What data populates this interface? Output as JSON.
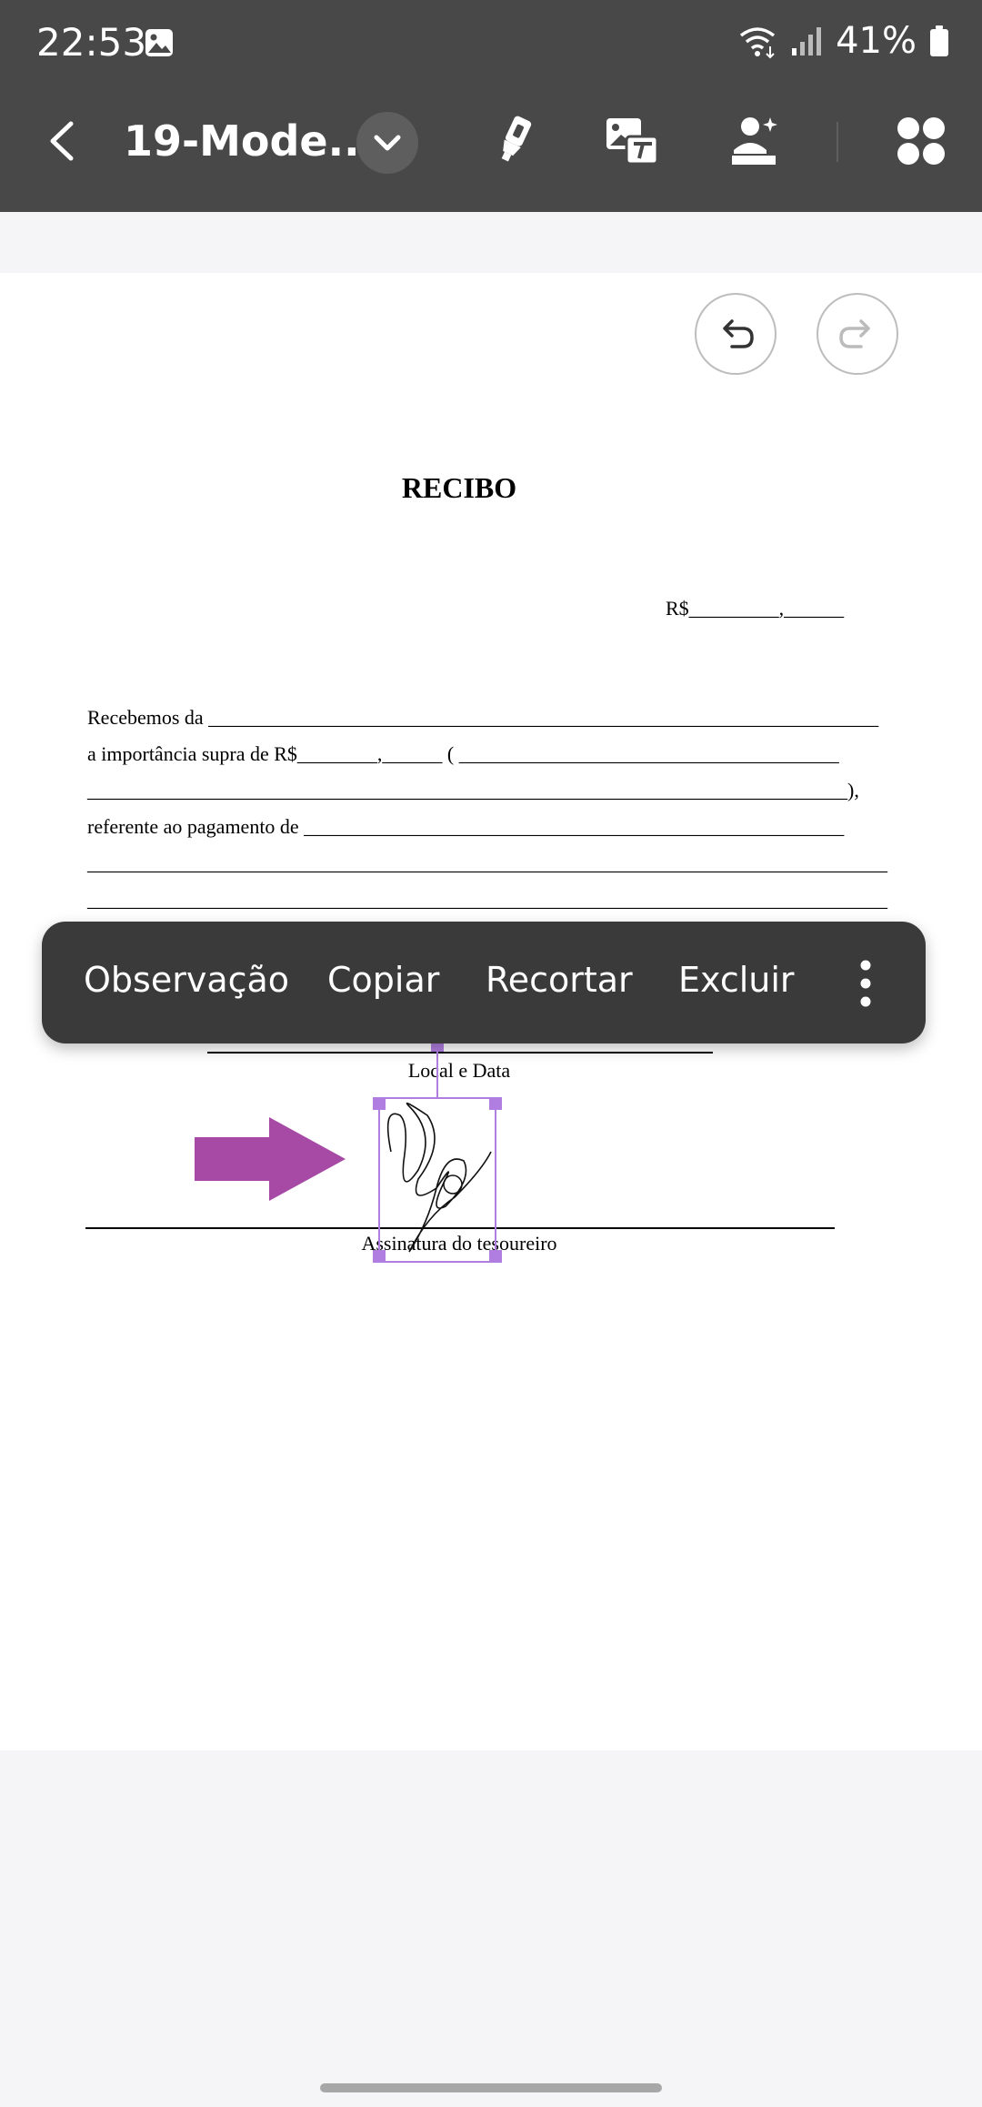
{
  "status_bar": {
    "time": "22:53",
    "battery": "41%"
  },
  "toolbar": {
    "title": "19-Mode..."
  },
  "document": {
    "title": "RECIBO",
    "amount_line": "R$_________,______",
    "lines": [
      "Recebemos da ___________________________________________________________________",
      "a importância supra de R$________,______ ( ______________________________________",
      "____________________________________________________________________________),",
      "referente ao pagamento de  ______________________________________________________",
      "________________________________________________________________________________",
      "________________________________________________________________________________"
    ],
    "local_date_caption": "Local e Data",
    "treasurer_caption": "Assinatura do tesoureiro"
  },
  "context_menu": {
    "items": [
      "Observação",
      "Copiar",
      "Recortar",
      "Excluir"
    ]
  },
  "colors": {
    "toolbar_bg": "#484848",
    "menu_bg": "#3a3a3a",
    "arrow": "#a64aa6",
    "selection": "#b07ee0"
  }
}
